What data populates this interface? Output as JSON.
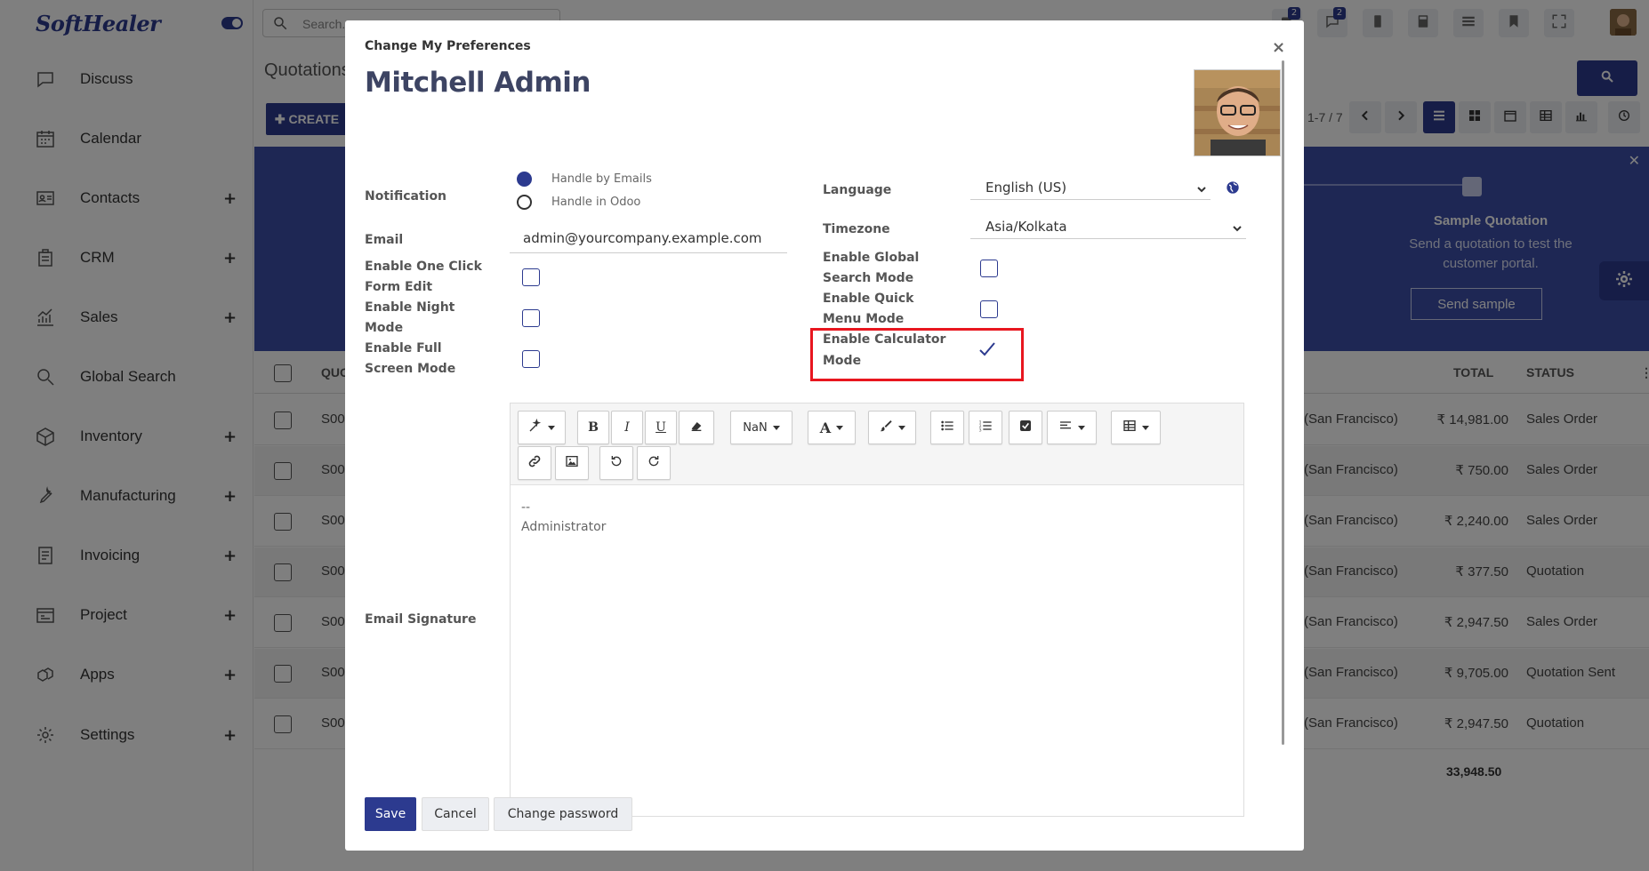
{
  "sidebar": {
    "brand": "SoftHealer",
    "items": [
      {
        "label": "Discuss",
        "icon": "discuss-icon",
        "plus": ""
      },
      {
        "label": "Calendar",
        "icon": "calendar-icon",
        "plus": ""
      },
      {
        "label": "Contacts",
        "icon": "contacts-icon",
        "plus": "+"
      },
      {
        "label": "CRM",
        "icon": "crm-icon",
        "plus": "+"
      },
      {
        "label": "Sales",
        "icon": "sales-icon",
        "plus": "+"
      },
      {
        "label": "Global Search",
        "icon": "search-icon",
        "plus": ""
      },
      {
        "label": "Inventory",
        "icon": "inventory-icon",
        "plus": "+"
      },
      {
        "label": "Manufacturing",
        "icon": "wrench-icon",
        "plus": "+"
      },
      {
        "label": "Invoicing",
        "icon": "invoice-icon",
        "plus": "+"
      },
      {
        "label": "Project",
        "icon": "project-icon",
        "plus": "+"
      },
      {
        "label": "Apps",
        "icon": "apps-icon",
        "plus": "+"
      },
      {
        "label": "Settings",
        "icon": "gear-icon",
        "plus": "+"
      }
    ]
  },
  "topbar": {
    "search_placeholder": "Search...",
    "activity_badge": "2",
    "messages_badge": "2"
  },
  "control_panel": {
    "breadcrumb": "Quotations",
    "create_label": "✚ CREATE",
    "pager": "1-7 / 7"
  },
  "banner": {
    "title": "Sample Quotation",
    "description": "Send a quotation to test the customer portal.",
    "send_label": "Send sample"
  },
  "list": {
    "headers": {
      "number": "QUO",
      "total": "TOTAL",
      "status": "STATUS"
    },
    "rows": [
      {
        "number": "S00",
        "customer": "(San Francisco)",
        "total": "₹ 14,981.00",
        "status": "Sales Order"
      },
      {
        "number": "S00",
        "customer": "(San Francisco)",
        "total": "₹ 750.00",
        "status": "Sales Order"
      },
      {
        "number": "S00",
        "customer": "(San Francisco)",
        "total": "₹ 2,240.00",
        "status": "Sales Order"
      },
      {
        "number": "S00",
        "customer": "(San Francisco)",
        "total": "₹ 377.50",
        "status": "Quotation"
      },
      {
        "number": "S00",
        "customer": "(San Francisco)",
        "total": "₹ 2,947.50",
        "status": "Sales Order"
      },
      {
        "number": "S00",
        "customer": "(San Francisco)",
        "total": "₹ 9,705.00",
        "status": "Quotation Sent"
      },
      {
        "number": "S00",
        "customer": "(San Francisco)",
        "total": "₹ 2,947.50",
        "status": "Quotation"
      }
    ],
    "sum_total": "33,948.50"
  },
  "modal": {
    "subtitle": "Change My Preferences",
    "title": "Mitchell Admin",
    "close": "×",
    "notification_label": "Notification",
    "notify_emails": "Handle by Emails",
    "notify_odoo": "Handle in Odoo",
    "email_label": "Email",
    "email_value": "admin@yourcompany.example.com",
    "one_click_label_1": "Enable One Click",
    "one_click_label_2": "Form Edit",
    "night_label_1": "Enable Night",
    "night_label_2": "Mode",
    "fullscreen_label_1": "Enable Full",
    "fullscreen_label_2": "Screen Mode",
    "language_label": "Language",
    "language_value": "English (US)",
    "timezone_label": "Timezone",
    "timezone_value": "Asia/Kolkata",
    "global_search_label_1": "Enable Global",
    "global_search_label_2": "Search Mode",
    "quick_menu_label_1": "Enable Quick",
    "quick_menu_label_2": "Menu Mode",
    "calculator_label_1": "Enable Calculator",
    "calculator_label_2": "Mode",
    "signature_label": "Email Signature",
    "font_size_label": "NaN",
    "signature_line_1": "--",
    "signature_line_2": "Administrator",
    "save_label": "Save",
    "cancel_label": "Cancel",
    "change_password_label": "Change password"
  },
  "colors": {
    "brand": "#2c3a8f",
    "highlight": "#e8161f"
  }
}
